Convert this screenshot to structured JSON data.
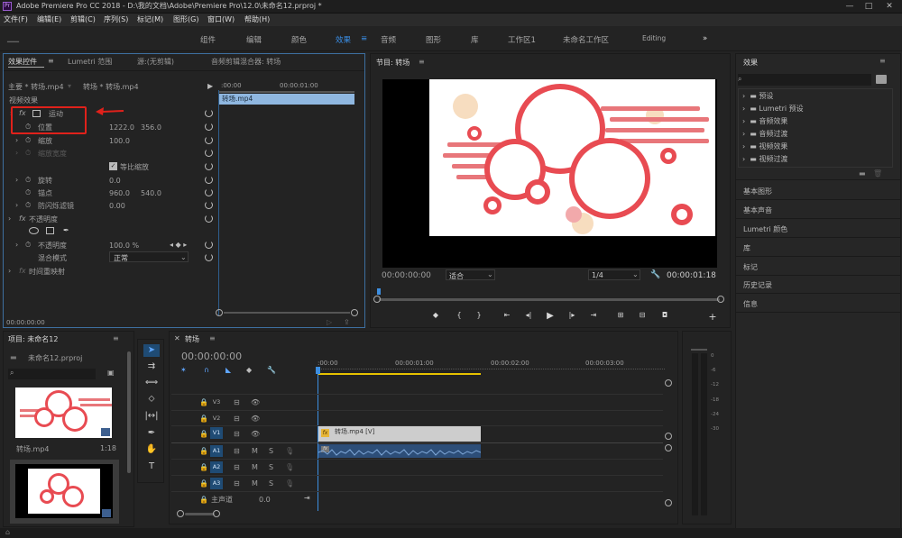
{
  "window": {
    "title": "Adobe Premiere Pro CC 2018 - D:\\我的文档\\Adobe\\Premiere Pro\\12.0\\未命名12.prproj *",
    "app_icon": "Pr"
  },
  "menu": [
    "文件(F)",
    "编辑(E)",
    "剪辑(C)",
    "序列(S)",
    "标记(M)",
    "图形(G)",
    "窗口(W)",
    "帮助(H)"
  ],
  "workspaces": [
    "组件",
    "编辑",
    "颜色",
    "效果",
    "音频",
    "图形",
    "库",
    "工作区1",
    "未命名工作区",
    "Editing"
  ],
  "active_workspace": "效果",
  "effect_controls": {
    "tabs": [
      "效果控件",
      "Lumetri 范围",
      "源:(无剪辑)",
      "音频剪辑混合器: 转场"
    ],
    "master_label": "主要 * 转场.mp4",
    "clip_label": "转场 * 转场.mp4",
    "ruler_start": ":00:00",
    "ruler_mid": "00:00:01:00",
    "clip_bar": "转场.mp4",
    "section_video": "视频效果",
    "motion": "运动",
    "position": "位置",
    "position_x": "1222.0",
    "position_y": "356.0",
    "scale": "缩放",
    "scale_val": "100.0",
    "scale_width": "缩放宽度",
    "uniform_scale": "等比缩放",
    "rotation": "旋转",
    "rotation_val": "0.0",
    "anchor": "锚点",
    "anchor_x": "960.0",
    "anchor_y": "540.0",
    "antiflicker": "防闪烁滤镜",
    "antiflicker_val": "0.00",
    "opacity_section": "不透明度",
    "opacity": "不透明度",
    "opacity_val": "100.0 %",
    "blend_mode": "混合模式",
    "blend_val": "正常",
    "time_remap": "时间重映射",
    "timecode": "00:00:00:00"
  },
  "program": {
    "title": "节目: 转场",
    "timecode": "00:00:00:00",
    "fit": "适合",
    "quality": "1/4",
    "duration": "00:00:01:18"
  },
  "effects_panel": {
    "title": "效果",
    "items": [
      "预设",
      "Lumetri 预设",
      "音频效果",
      "音频过渡",
      "视频效果",
      "视频过渡"
    ],
    "sections": [
      "基本图形",
      "基本声音",
      "Lumetri 颜色",
      "库",
      "标记",
      "历史记录",
      "信息"
    ]
  },
  "project": {
    "title": "项目: 未命名12",
    "file": "未命名12.prproj",
    "clip_name": "转场.mp4",
    "clip_dur": "1:18"
  },
  "timeline": {
    "title": "转场",
    "timecode": "00:00:00:00",
    "ruler": [
      ":00:00",
      "00:00:01:00",
      "00:00:02:00",
      "00:00:03:00"
    ],
    "video_tracks": [
      "V3",
      "V2",
      "V1"
    ],
    "audio_tracks": [
      "A1",
      "A2",
      "A3"
    ],
    "master": "主声道",
    "master_val": "0.0",
    "clip_label": "转场.mp4 [V]",
    "fx": "fx",
    "m": "M",
    "s": "S"
  },
  "meter_ticks": [
    "0",
    "-6",
    "-12",
    "-18",
    "-24",
    "-30"
  ],
  "colors": {
    "accent": "#3d8ee0",
    "red_box": "#e0211b",
    "video_clip": "#cdcdcd",
    "audio_clip": "#2d4e78"
  }
}
